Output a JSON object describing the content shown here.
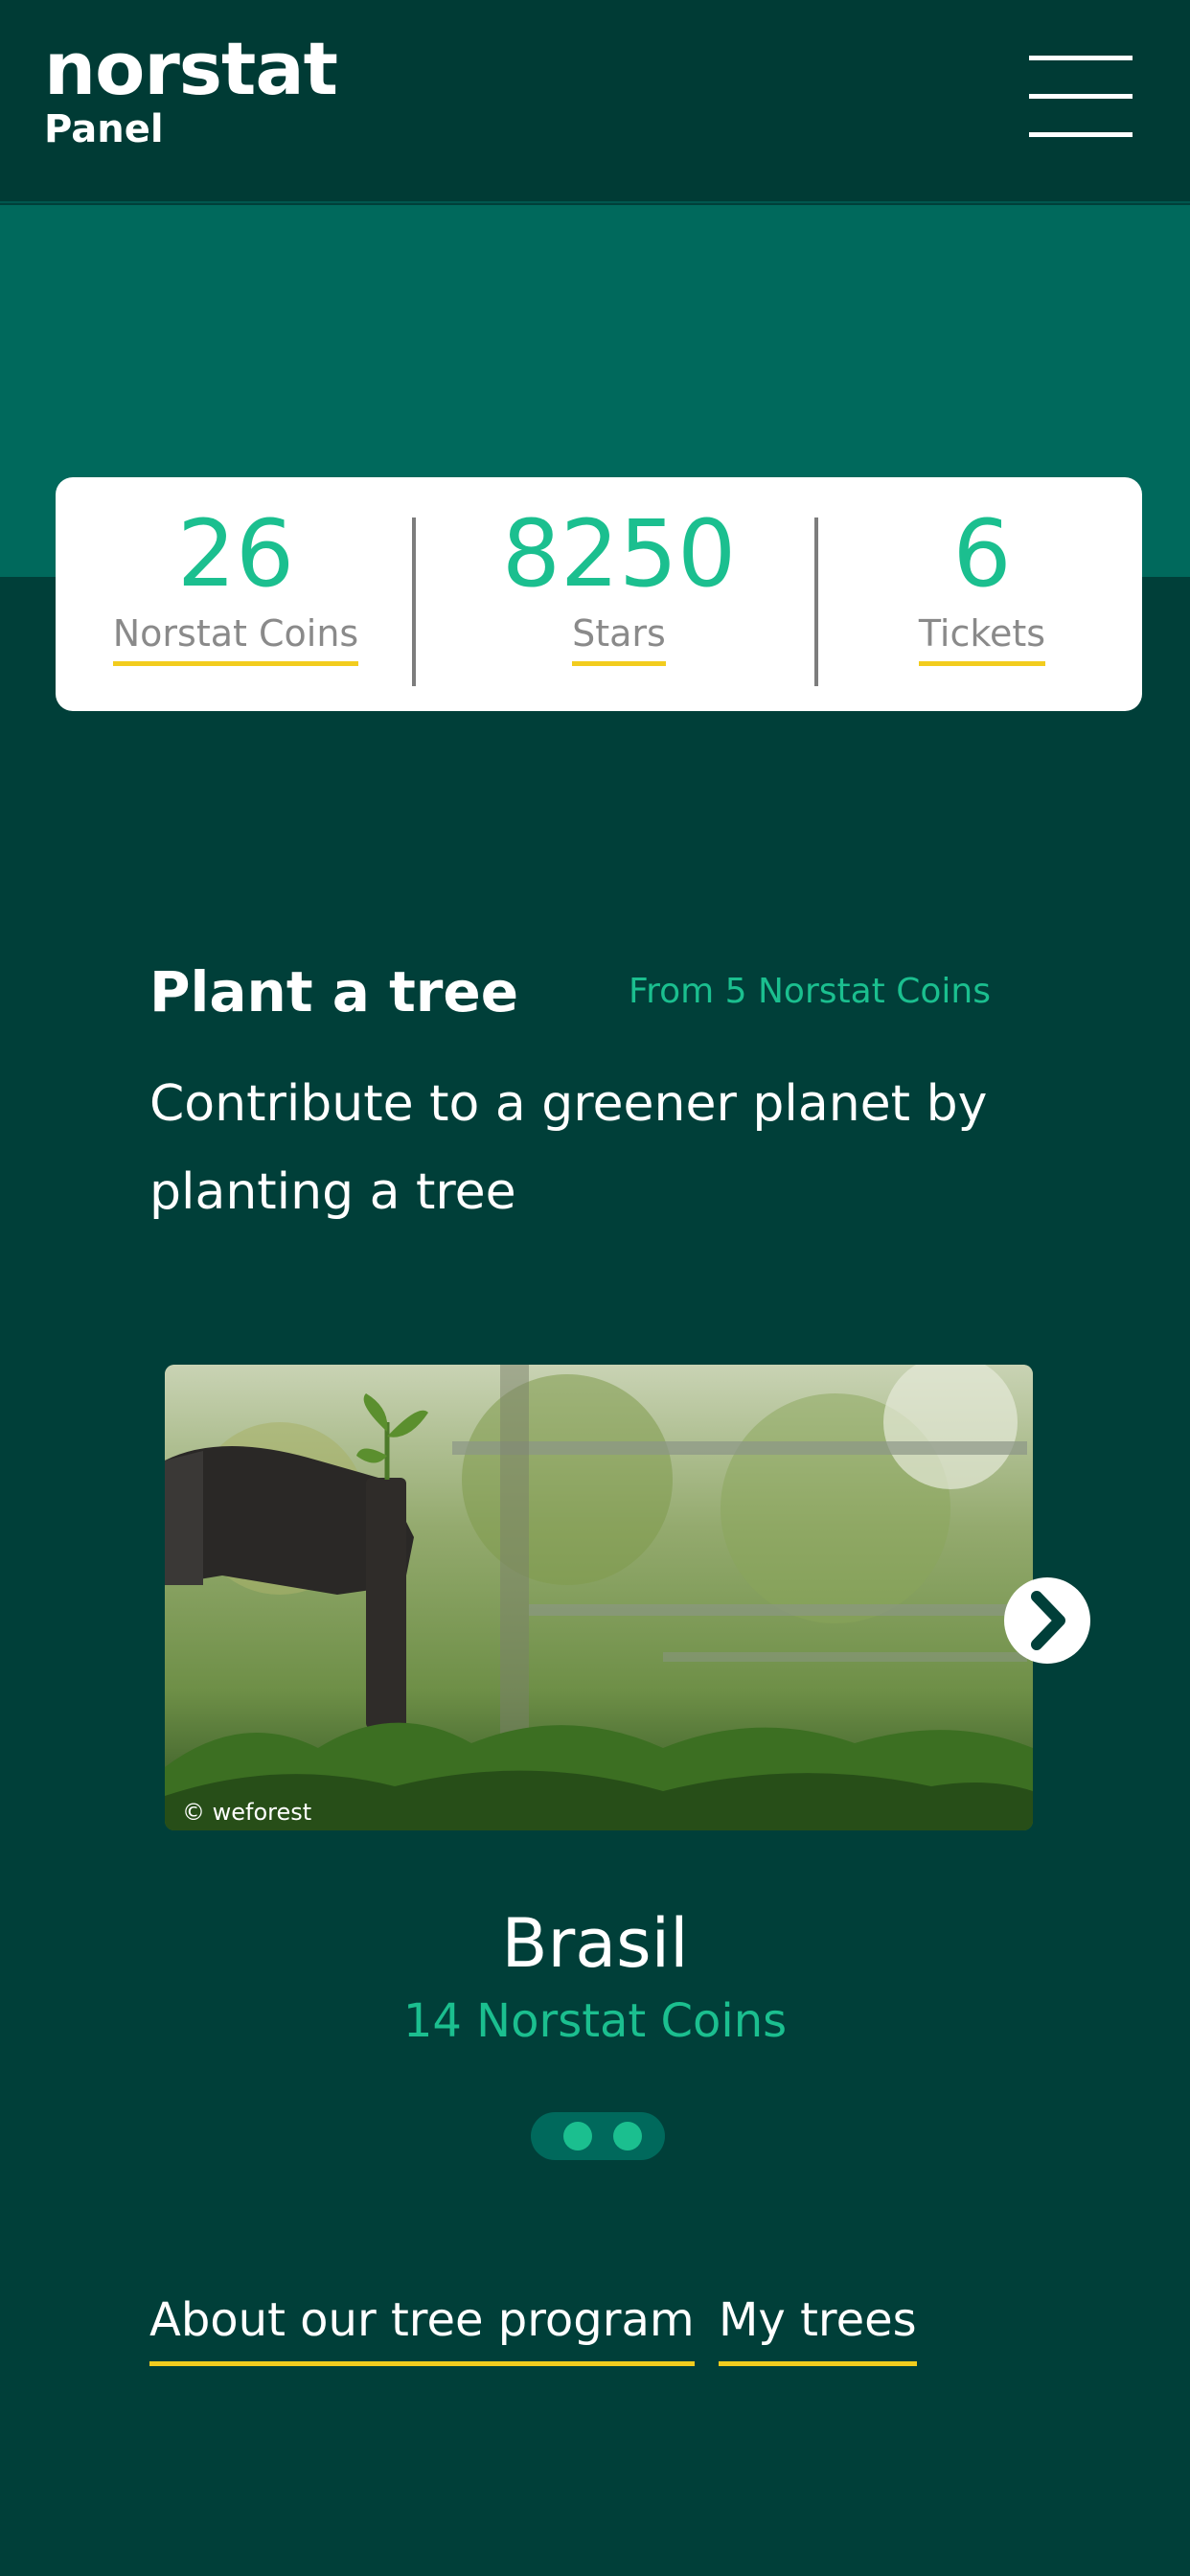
{
  "header": {
    "logo_main": "norstat",
    "logo_sub": "Panel",
    "menu_icon": "hamburger-menu-icon"
  },
  "stats": [
    {
      "value": "26",
      "label": "Norstat Coins"
    },
    {
      "value": "8250",
      "label": "Stars"
    },
    {
      "value": "6",
      "label": "Tickets"
    }
  ],
  "plant": {
    "title": "Plant a tree",
    "price": "From 5 Norstat Coins",
    "description": "Contribute to a greener planet by planting a tree"
  },
  "carousel": {
    "photo_credit": "© weforest",
    "place_name": "Brasil",
    "place_price": "14 Norstat Coins",
    "next_icon": "chevron-right-icon"
  },
  "links": {
    "about": "About our tree program",
    "my_trees": "My trees"
  },
  "colors": {
    "background": "#003f39",
    "header": "#003b35",
    "band": "#00695c",
    "accent_green": "#1bbf8f",
    "underline_yellow": "#f2cc1e"
  }
}
